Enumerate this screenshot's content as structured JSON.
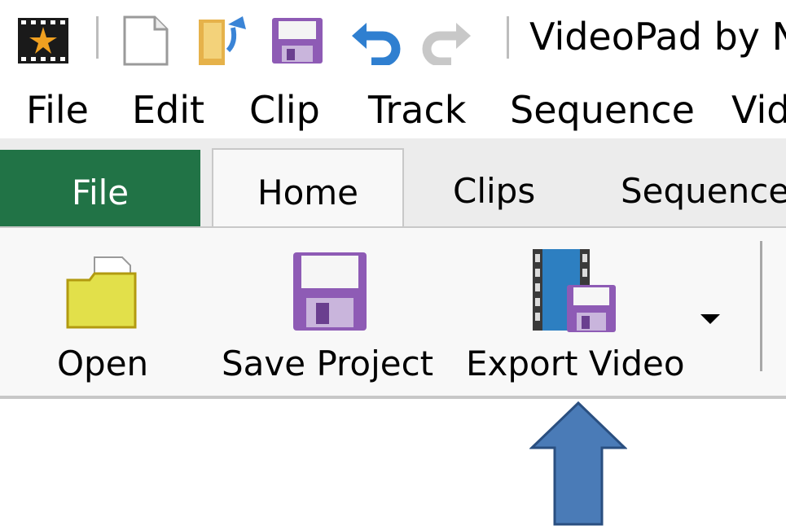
{
  "title_bar": {
    "title": "VideoPad by N",
    "quick_access": [
      "app-logo-icon",
      "new-file-icon",
      "open-folder-icon",
      "save-icon",
      "undo-icon",
      "redo-icon"
    ]
  },
  "menu": {
    "items": [
      "File",
      "Edit",
      "Clip",
      "Track",
      "Sequence",
      "Vid"
    ]
  },
  "ribbon_tabs": [
    {
      "label": "File",
      "color": "#217346"
    },
    {
      "label": "Home",
      "selected": true
    },
    {
      "label": "Clips"
    },
    {
      "label": "Sequence"
    }
  ],
  "ribbon": {
    "open_label": "Open",
    "save_label": "Save Project",
    "export_label": "Export Video"
  },
  "colors": {
    "file_tab": "#217346",
    "folder": "#e2e04a",
    "floppy": "#8e5bb5",
    "film": "#2d7fc1",
    "annotation_arrow": "#4a7bb7"
  }
}
